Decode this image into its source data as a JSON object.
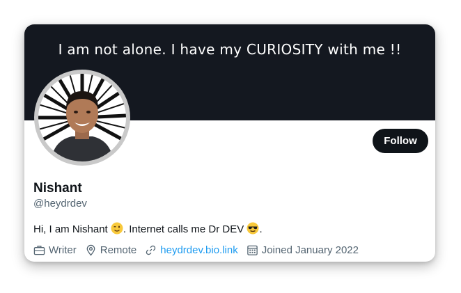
{
  "banner": {
    "text": "I am not alone. I have my CURIOSITY with me !!"
  },
  "profile": {
    "name": "Nishant",
    "handle": "@heydrdev",
    "follow_label": "Follow",
    "bio": {
      "part1": "Hi, I am Nishant ",
      "emoji1": "winking-face-emoji",
      "part2": ". Internet calls me Dr DEV ",
      "emoji2": "sunglasses-face-emoji",
      "part3": "."
    }
  },
  "meta": {
    "profession": "Writer",
    "location": "Remote",
    "website": "heydrdev.bio.link",
    "joined": "Joined January 2022"
  },
  "icons": {
    "profession": "briefcase-icon",
    "location": "location-pin-icon",
    "website": "link-icon",
    "joined": "calendar-icon"
  },
  "colors": {
    "banner_bg": "#141820",
    "follow_bg": "#0f1419",
    "link": "#1d9bf0",
    "secondary_text": "#536471"
  }
}
